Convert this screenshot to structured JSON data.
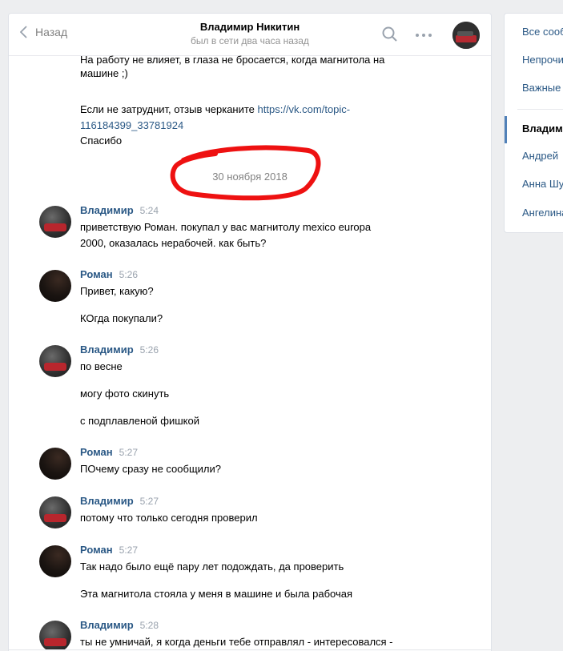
{
  "header": {
    "back_label": "Назад",
    "contact_name": "Владимир Никитин",
    "contact_status": "был в сети два часа назад"
  },
  "history": {
    "clipped_top": "На работу не влияет, в глаза не бросается, когда магнитола на",
    "earlier_lines": [
      "машине ;)",
      "Если не затруднит, отзыв черканите ",
      "https://vk.com/topic-",
      "116184399_33781924",
      "Спасибо"
    ],
    "date_separator": "30 ноября 2018",
    "messages": [
      {
        "author": "Владимир",
        "time": "5:24",
        "lines": [
          "приветствую Роман. покупал у вас магнитолу mexico europa",
          "2000, оказалась нерабочей. как быть?"
        ]
      },
      {
        "author": "Роман",
        "time": "5:26",
        "lines": [
          "Привет, какую?",
          "",
          "КОгда покупали?"
        ]
      },
      {
        "author": "Владимир",
        "time": "5:26",
        "lines": [
          "по весне",
          "",
          "могу фото скинуть",
          "",
          "с подплавленой фишкой"
        ]
      },
      {
        "author": "Роман",
        "time": "5:27",
        "lines": [
          "ПОчему сразу не сообщили?"
        ]
      },
      {
        "author": "Владимир",
        "time": "5:27",
        "lines": [
          "потому что только сегодня проверил"
        ]
      },
      {
        "author": "Роман",
        "time": "5:27",
        "lines": [
          "Так надо было ещё пару лет подождать, да проверить",
          "",
          "Эта магнитола стояла у меня в машине и была рабочая"
        ]
      },
      {
        "author": "Владимир",
        "time": "5:28",
        "lines": [
          "ты не умничай, я когда деньги тебе отправлял - интересовался -"
        ]
      }
    ]
  },
  "folders": {
    "items": [
      "Все сообщения",
      "Непрочитанные",
      "Важные"
    ],
    "dialogs": [
      "Владимир",
      "Андрей",
      "Анна Шу",
      "Ангелина"
    ],
    "active_index": 0
  },
  "colors": {
    "link": "#2a5885",
    "meta": "#99a2ad",
    "annotation": "#ee1111"
  }
}
